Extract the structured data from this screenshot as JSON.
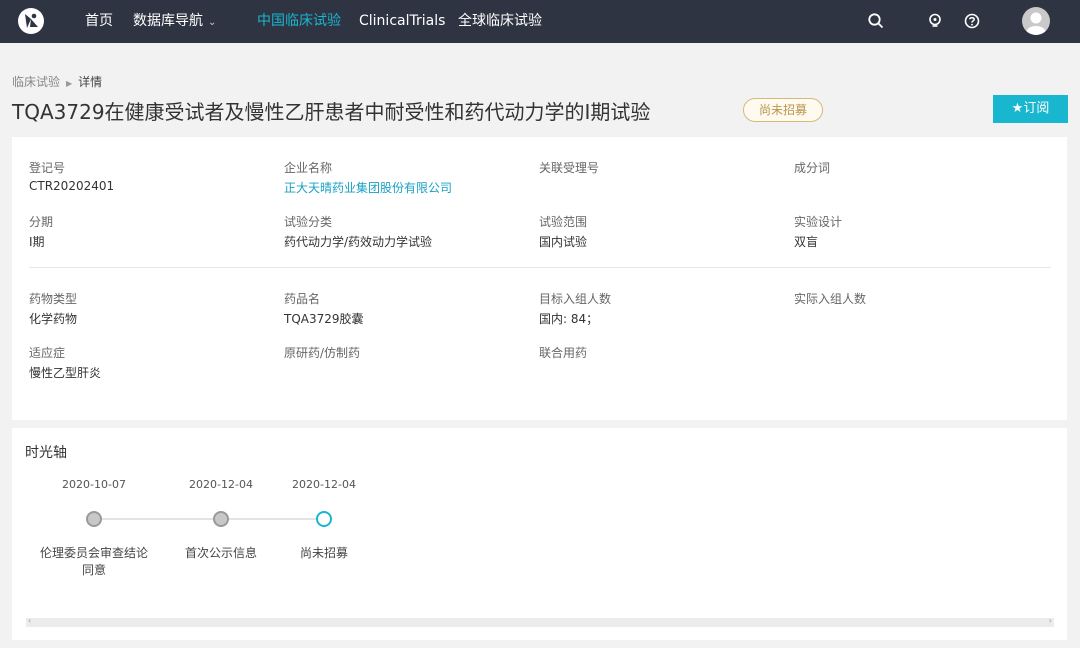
{
  "nav": {
    "home": "首页",
    "db_nav": "数据库导航",
    "china_trials": "中国临床试验",
    "clinicaltrials": "ClinicalTrials",
    "global_trials": "全球临床试验"
  },
  "icons": {
    "logo": "logo-icon",
    "search": "search-icon",
    "bulb": "lightbulb-icon",
    "help": "help-icon",
    "avatar": "avatar-icon"
  },
  "colors": {
    "accent": "#19b6d0",
    "nav_bg": "#2e3441",
    "badge": "#b8954a"
  },
  "breadcrumb": {
    "parent": "临床试验",
    "current": "详情"
  },
  "title": "TQA3729在健康受试者及慢性乙肝患者中耐受性和药代动力学的Ⅰ期试验",
  "status_badge": "尚未招募",
  "subscribe": "★订阅",
  "info": {
    "reg_no": {
      "label": "登记号",
      "value": "CTR20202401"
    },
    "company": {
      "label": "企业名称",
      "value": "正大天晴药业集团股份有限公司"
    },
    "related_no": {
      "label": "关联受理号",
      "value": ""
    },
    "ingredient": {
      "label": "成分词",
      "value": ""
    },
    "phase": {
      "label": "分期",
      "value": "I期"
    },
    "trial_type": {
      "label": "试验分类",
      "value": "药代动力学/药效动力学试验"
    },
    "scope": {
      "label": "试验范围",
      "value": "国内试验"
    },
    "design": {
      "label": "实验设计",
      "value": "双盲"
    },
    "drug_type": {
      "label": "药物类型",
      "value": "化学药物"
    },
    "drug_name": {
      "label": "药品名",
      "value": "TQA3729胶囊"
    },
    "target_enroll": {
      "label": "目标入组人数",
      "value": "国内: 84；"
    },
    "actual_enroll": {
      "label": "实际入组人数",
      "value": ""
    },
    "indication": {
      "label": "适应症",
      "value": "慢性乙型肝炎"
    },
    "orig_generic": {
      "label": "原研药/仿制药",
      "value": ""
    },
    "combo": {
      "label": "联合用药",
      "value": ""
    }
  },
  "timeline": {
    "title": "时光轴",
    "events": [
      {
        "date": "2020-10-07",
        "label": "伦理委员会审查结论同意"
      },
      {
        "date": "2020-12-04",
        "label": "首次公示信息"
      },
      {
        "date": "2020-12-04",
        "label": "尚未招募"
      }
    ]
  }
}
